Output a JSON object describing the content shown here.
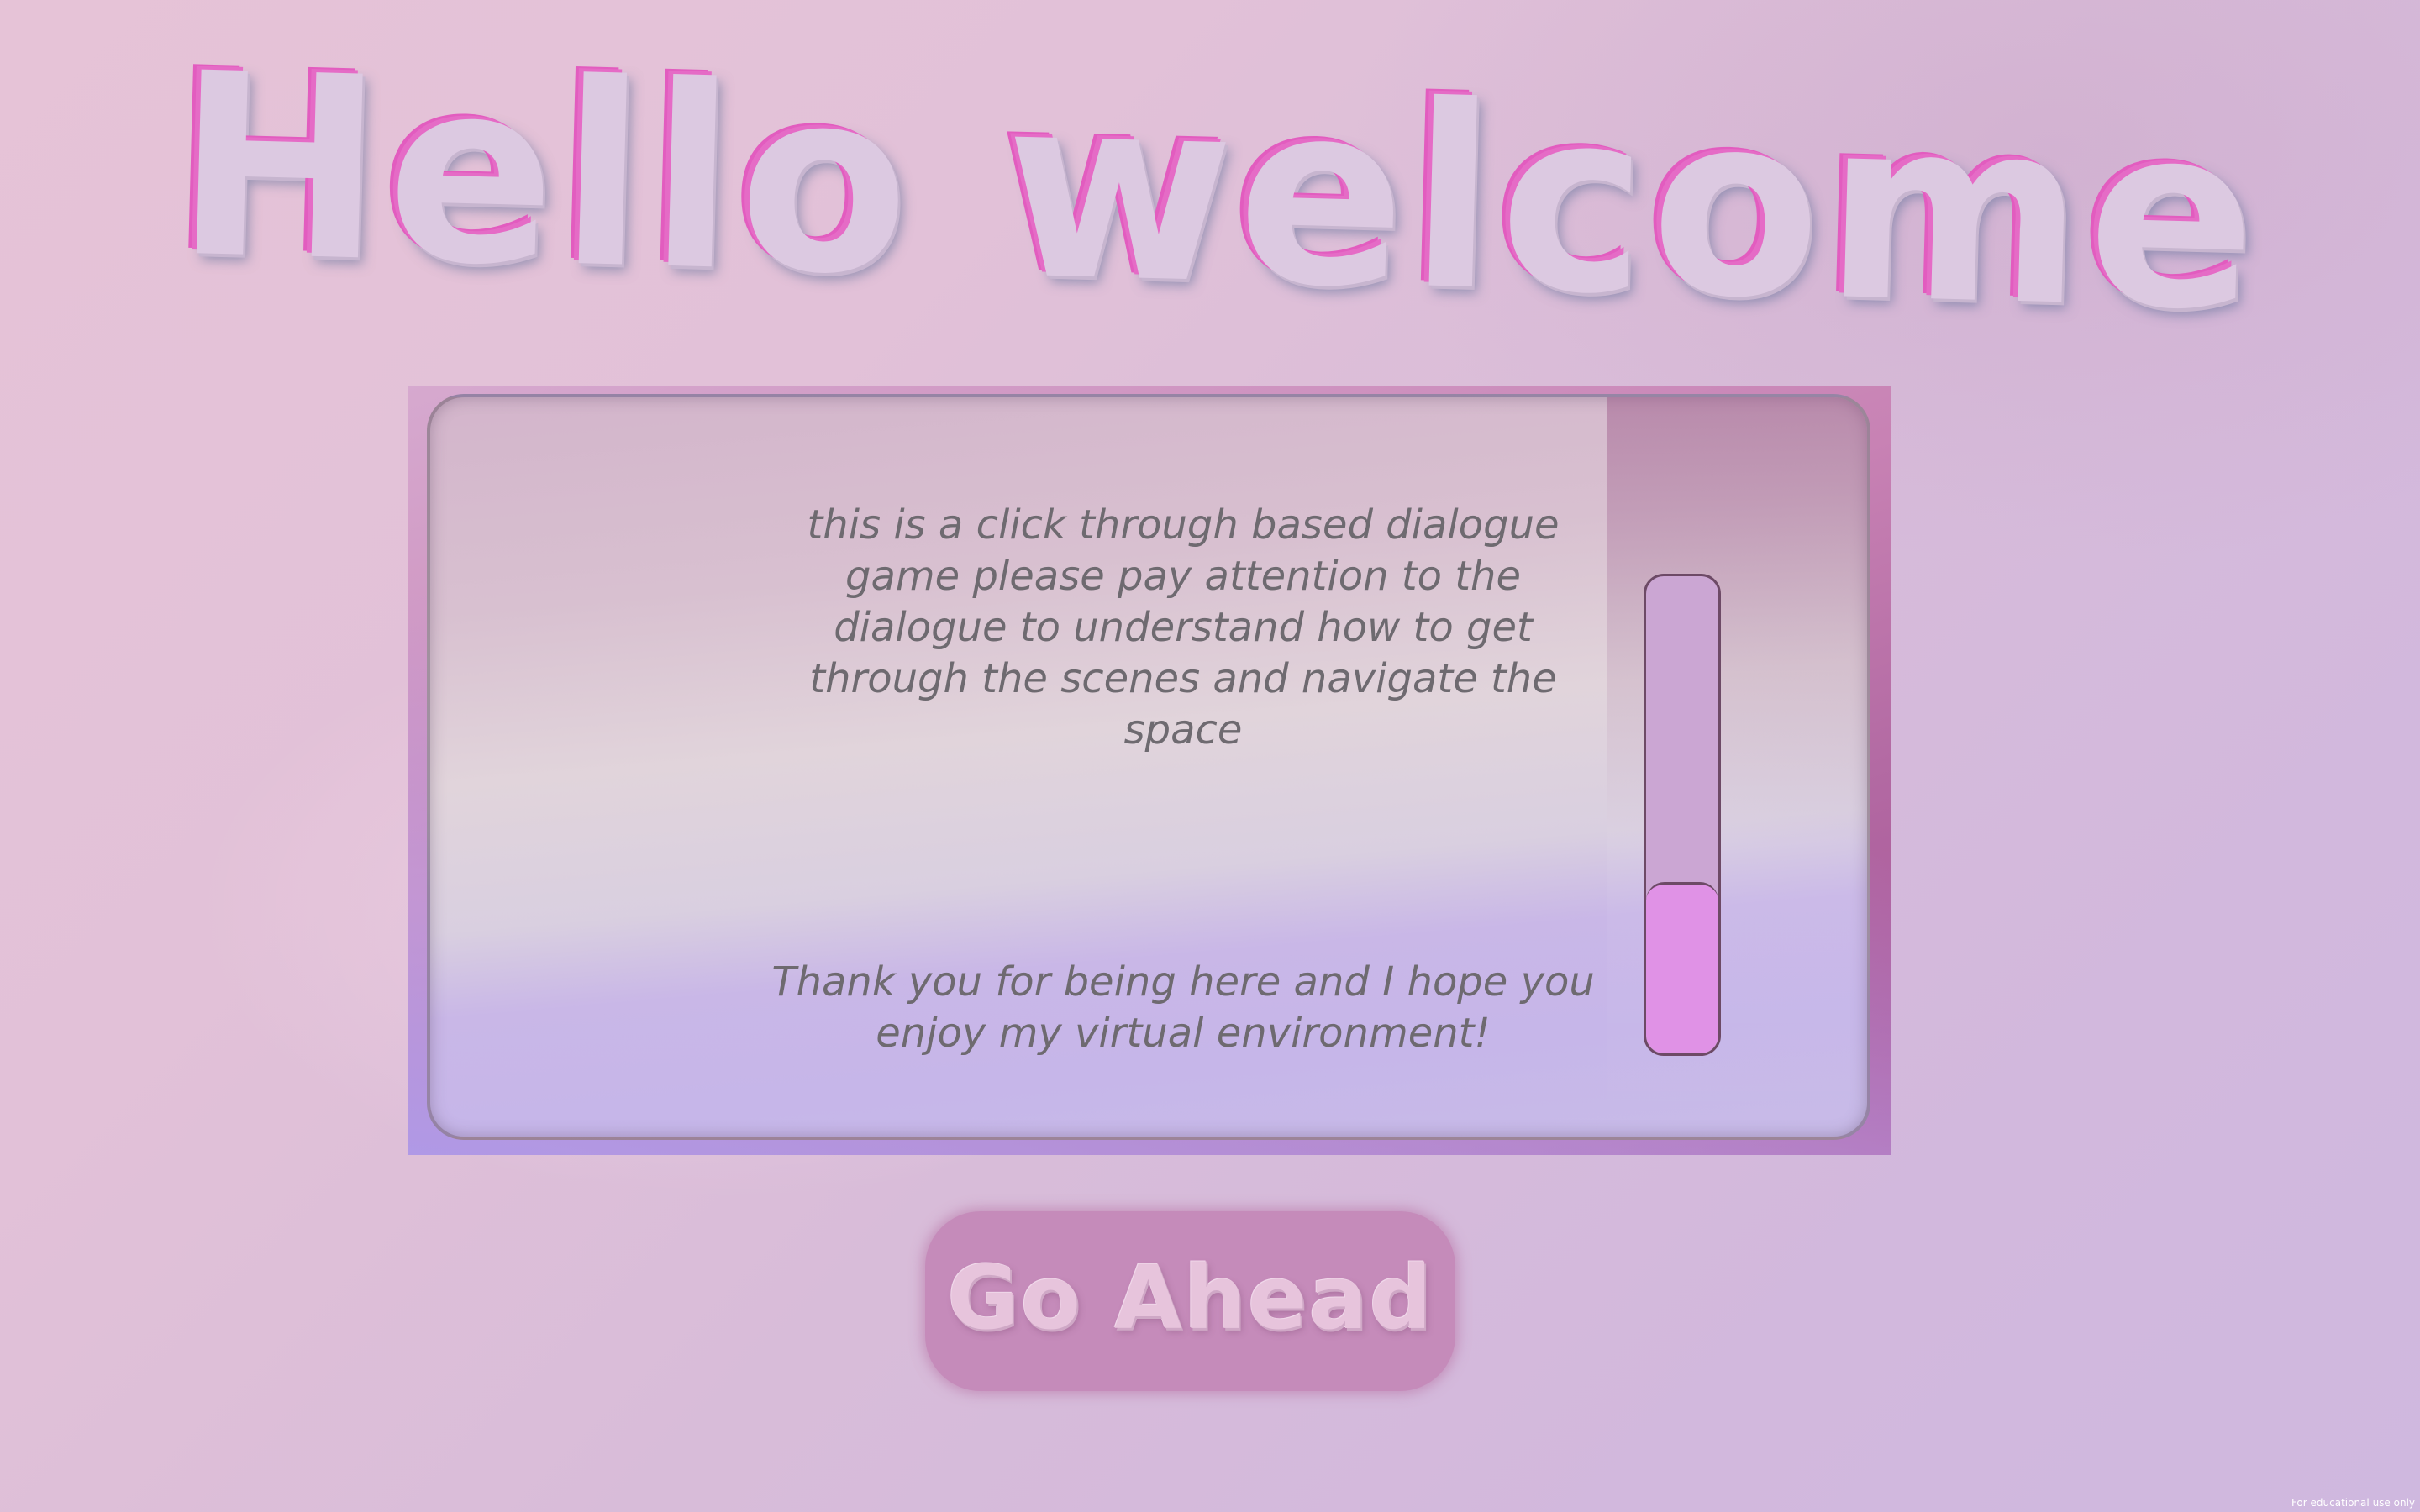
{
  "title": "Hello welcome",
  "dialogue": {
    "paragraph_1": "this is a click through based dialogue game please pay attention to the dialogue to understand how to get through the scenes and navigate the space",
    "paragraph_2": "Thank you for being here and I hope you enjoy my virtual environment!"
  },
  "scrollbar": {
    "fill_fraction": 0.36
  },
  "button": {
    "label": "Go Ahead"
  },
  "footer": {
    "note": "For educational use only"
  },
  "colors": {
    "title_outline": "#e25cbf",
    "panel_border": "#a54d92",
    "scroll_thumb": "#e092e6",
    "button_bg": "#c58bba",
    "dialogue_text": "#6e6a70"
  }
}
